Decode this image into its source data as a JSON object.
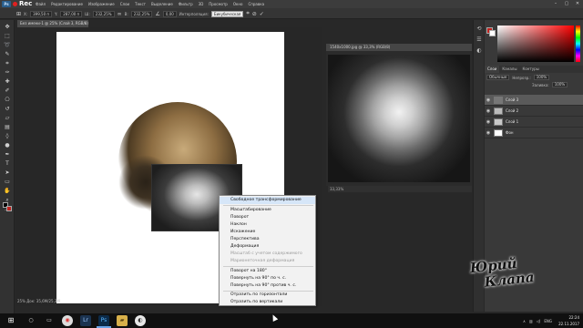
{
  "menubar": {
    "rec_label": "Rec",
    "items": [
      "Файл",
      "Редактирование",
      "Изображение",
      "Слои",
      "Текст",
      "Выделение",
      "Фильтр",
      "3D",
      "Просмотр",
      "Окно",
      "Справка"
    ]
  },
  "options": {
    "x_label": "X:",
    "x_value": "399,50 п",
    "y_label": "Y:",
    "y_value": "287,00 п",
    "w_label": "Ш:",
    "w_value": "232,25%",
    "h_label": "В:",
    "h_value": "232,25%",
    "angle_value": "0,00",
    "interp_label": "Интерполяция:",
    "interp_value": "Бикубическая",
    "commit_icon": "check-icon",
    "cancel_icon": "cancel-icon"
  },
  "document": {
    "tab_title": "Без имени-1 @ 25% (Слой 3, RGB/8) *",
    "zoom_status": "25%",
    "doc_status": "Док: 35,6M/25,3M"
  },
  "doc2": {
    "tab_title": "1540x1000.jpg @ 33,3% (RGB/8)",
    "status": "33,33%"
  },
  "panels": {
    "color_tab_fg": "#c0221e",
    "tabs": [
      "Слои",
      "Каналы",
      "Контуры"
    ],
    "blend_mode": "Обычные",
    "opacity_label": "Непрозр.:",
    "opacity_value": "100%",
    "fill_label": "Заливка:",
    "fill_value": "100%",
    "layers": [
      {
        "name": "Слой 3",
        "selected": true
      },
      {
        "name": "Слой 2",
        "selected": false
      },
      {
        "name": "Слой 1",
        "selected": false
      },
      {
        "name": "Фон",
        "selected": false
      }
    ]
  },
  "context_menu": {
    "items": [
      {
        "label": "Свободное трансформирование",
        "state": "normal"
      },
      {
        "label": "Масштабирование",
        "state": "normal"
      },
      {
        "label": "Поворот",
        "state": "normal"
      },
      {
        "label": "Наклон",
        "state": "normal"
      },
      {
        "label": "Искажение",
        "state": "normal"
      },
      {
        "label": "Перспектива",
        "state": "normal"
      },
      {
        "label": "Деформация",
        "state": "normal"
      },
      {
        "label": "Масштаб с учетом содержимого",
        "state": "disabled"
      },
      {
        "label": "Марионеточная деформация",
        "state": "disabled"
      },
      {
        "label": "Поворот на 180°",
        "state": "normal"
      },
      {
        "label": "Повернуть на 90° по ч. с.",
        "state": "normal"
      },
      {
        "label": "Повернуть на 90° против ч. с.",
        "state": "normal"
      },
      {
        "label": "Отразить по горизонтали",
        "state": "normal"
      },
      {
        "label": "Отразить по вертикали",
        "state": "normal"
      }
    ]
  },
  "signature": {
    "line1": "Юрий",
    "line2": "Клапа"
  },
  "taskbar": {
    "lang": "ENG",
    "time": "22:24",
    "date": "22.11.2017"
  }
}
